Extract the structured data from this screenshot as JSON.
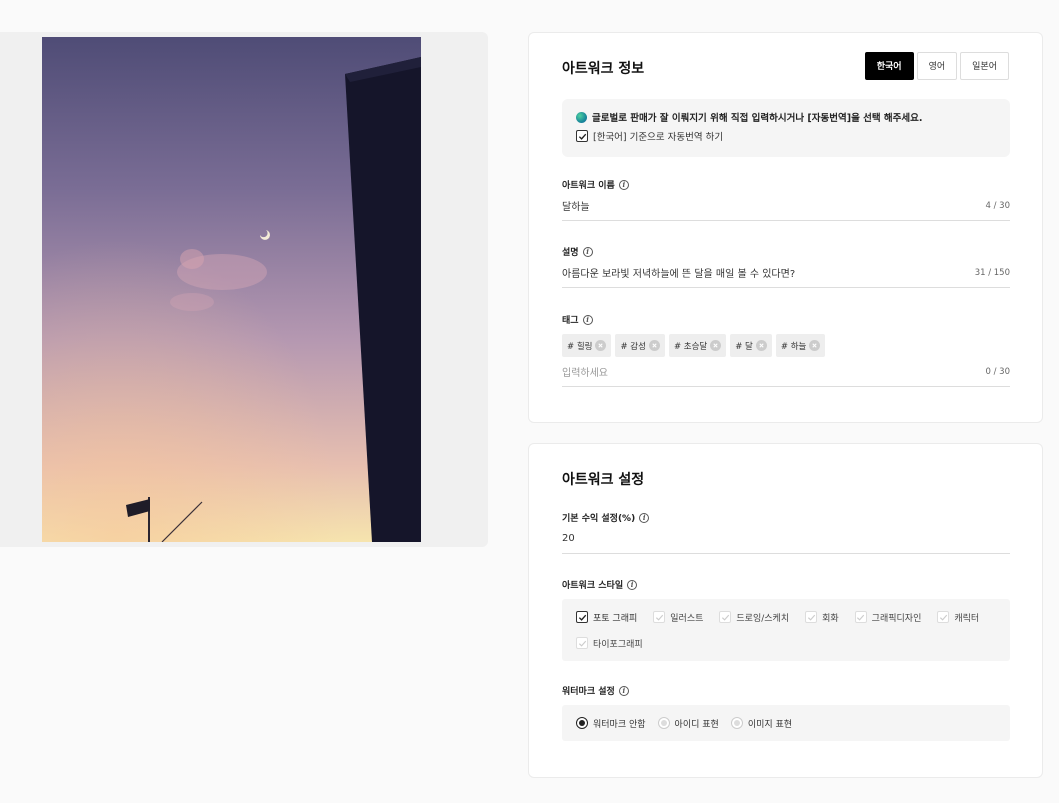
{
  "info": {
    "title": "아트워크 정보",
    "lang_tabs": [
      "한국어",
      "영어",
      "일본어"
    ],
    "notice_text": "글로벌로 판매가 잘 이뤄지기 위해 직접 입력하시거나 [자동번역]을 선택 해주세요.",
    "auto_translate_label": "[한국어] 기준으로 자동번역 하기",
    "name": {
      "label": "아트워크 이름",
      "value": "달하늘",
      "count": "4 / 30"
    },
    "description": {
      "label": "설명",
      "value": "아름다운 보라빛 저녁하늘에 뜬 달을 매일 볼 수 있다면?",
      "count": "31 / 150"
    },
    "tags": {
      "label": "태그",
      "items": [
        "# 힐링",
        "# 감성",
        "# 초승달",
        "# 달",
        "# 하늘"
      ],
      "placeholder": "입력하세요",
      "count": "0 / 30"
    }
  },
  "settings": {
    "title": "아트워크 설정",
    "revenue": {
      "label": "기본 수익 설정(%)",
      "value": "20"
    },
    "style": {
      "label": "아트워크 스타일",
      "options": [
        "포토 그래피",
        "일러스트",
        "드로잉/스케치",
        "회화",
        "그래픽디자인",
        "캐릭터",
        "타이포그래피"
      ],
      "checked_index": 0
    },
    "watermark": {
      "label": "워터마크 설정",
      "options": [
        "워터마크 안함",
        "아이디 표현",
        "이미지 표현"
      ],
      "selected_index": 0
    }
  },
  "colors": {
    "accent": "#000000",
    "panel": "#f0f0f0",
    "option_bg": "#f5f5f5"
  }
}
